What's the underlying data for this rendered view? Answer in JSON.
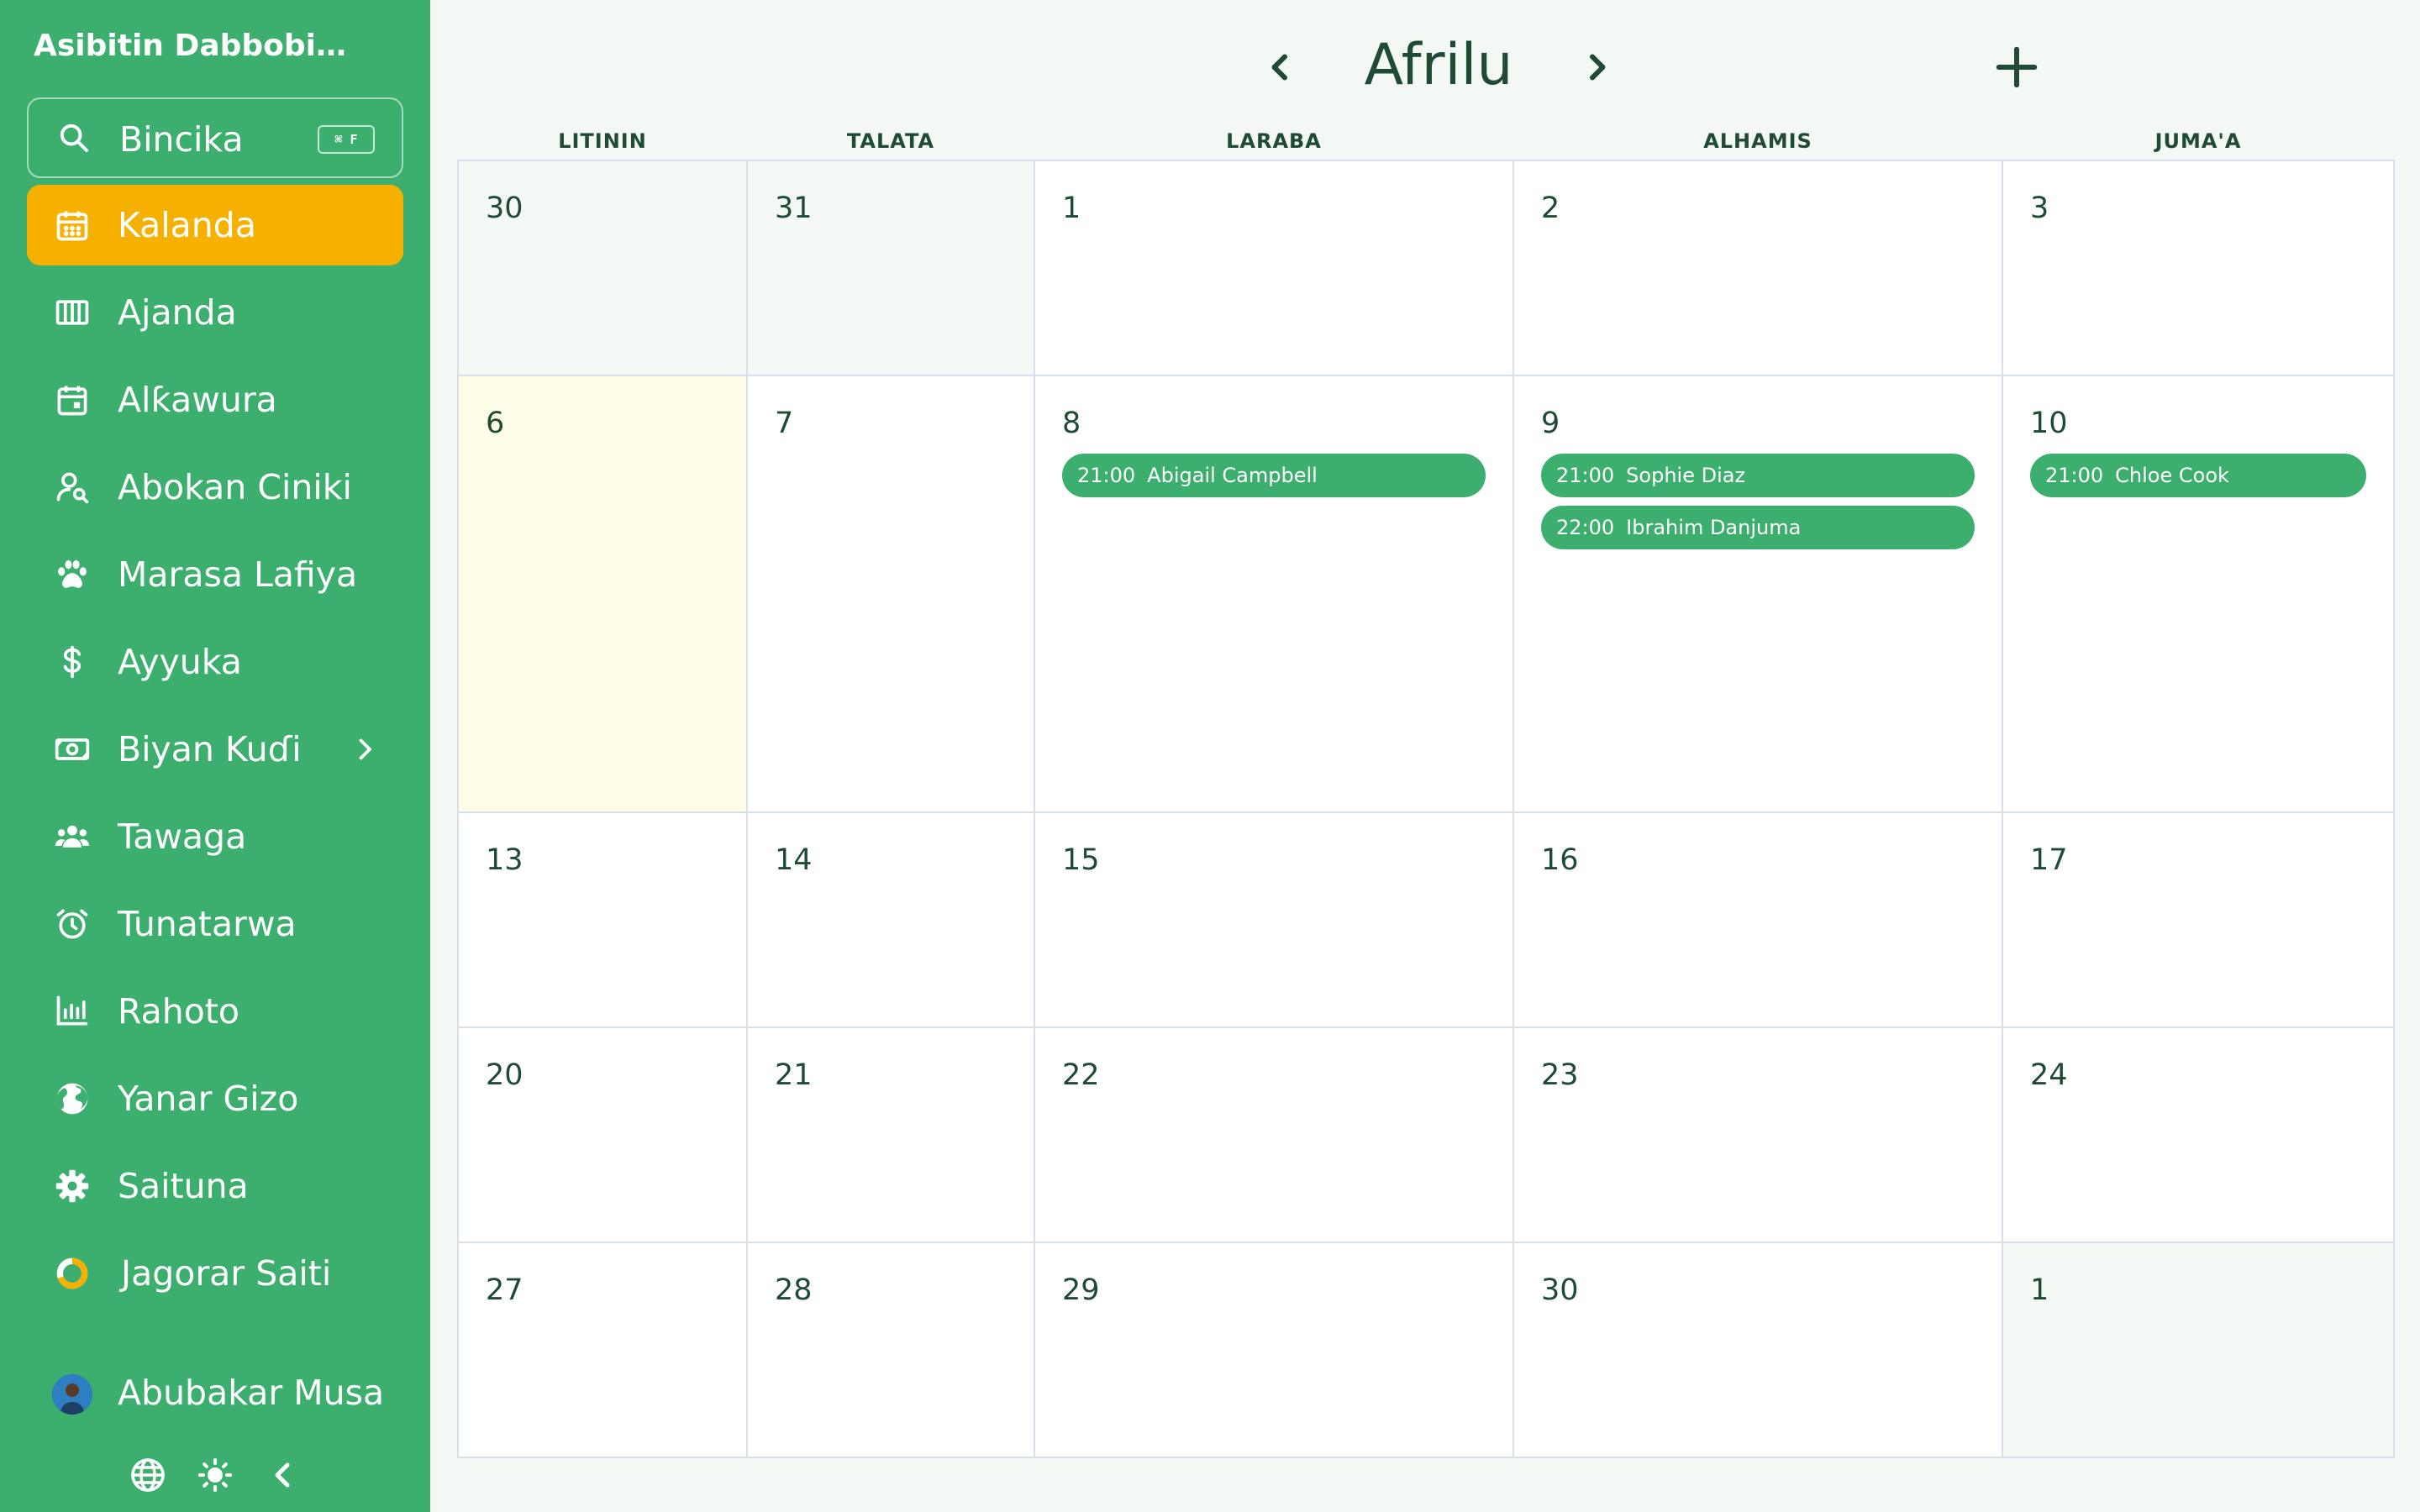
{
  "sidebar": {
    "clinic_name": "Asibitin Dabbobi M...",
    "search": {
      "label": "Bincika",
      "shortcut": "⌘ F"
    },
    "items": [
      {
        "label": "Kalanda",
        "icon": "calendar-icon",
        "active": true
      },
      {
        "label": "Ajanda",
        "icon": "agenda-columns-icon"
      },
      {
        "label": "Alƙawura",
        "icon": "appointment-icon"
      },
      {
        "label": "Abokan Ciniki",
        "icon": "client-search-icon"
      },
      {
        "label": "Marasa Lafiya",
        "icon": "paw-icon"
      },
      {
        "label": "Ayyuka",
        "icon": "dollar-icon"
      },
      {
        "label": "Biyan Kuɗi",
        "icon": "cash-icon",
        "has_submenu": true
      },
      {
        "label": "Tawaga",
        "icon": "team-icon"
      },
      {
        "label": "Tunatarwa",
        "icon": "alarm-icon"
      },
      {
        "label": "Rahoto",
        "icon": "bar-chart-icon"
      },
      {
        "label": "Yanar Gizo",
        "icon": "globe-icon"
      },
      {
        "label": "Saituna",
        "icon": "gear-icon"
      },
      {
        "label": "Jagorar Saiti",
        "icon": "progress-ring-icon"
      }
    ],
    "user": {
      "name": "Abubakar Musa"
    },
    "tools": [
      "language-globe-icon",
      "theme-sun-icon",
      "collapse-chevron-icon"
    ]
  },
  "header": {
    "month": "Afrilu",
    "prev_icon": "chevron-left-icon",
    "next_icon": "chevron-right-icon",
    "add_icon": "plus-icon"
  },
  "calendar": {
    "weekdays": [
      "LITININ",
      "TALATA",
      "LARABA",
      "ALHAMIS",
      "JUMA'A"
    ],
    "weeks": [
      [
        {
          "day": "30",
          "out": true
        },
        {
          "day": "31",
          "out": true
        },
        {
          "day": "1"
        },
        {
          "day": "2"
        },
        {
          "day": "3"
        }
      ],
      [
        {
          "day": "6",
          "today": true
        },
        {
          "day": "7"
        },
        {
          "day": "8",
          "events": [
            {
              "time": "21:00",
              "name": "Abigail Campbell"
            }
          ]
        },
        {
          "day": "9",
          "events": [
            {
              "time": "21:00",
              "name": "Sophie Diaz"
            },
            {
              "time": "22:00",
              "name": "Ibrahim Danjuma"
            }
          ]
        },
        {
          "day": "10",
          "events": [
            {
              "time": "21:00",
              "name": "Chloe Cook"
            }
          ]
        }
      ],
      [
        {
          "day": "13"
        },
        {
          "day": "14"
        },
        {
          "day": "15"
        },
        {
          "day": "16"
        },
        {
          "day": "17"
        }
      ],
      [
        {
          "day": "20"
        },
        {
          "day": "21"
        },
        {
          "day": "22"
        },
        {
          "day": "23"
        },
        {
          "day": "24"
        }
      ],
      [
        {
          "day": "27"
        },
        {
          "day": "28"
        },
        {
          "day": "29"
        },
        {
          "day": "30"
        },
        {
          "day": "1",
          "out": true
        }
      ]
    ]
  },
  "colors": {
    "sidebar": "#3caf6f",
    "active": "#f5b000",
    "event": "#3caf6f",
    "today": "#fefee8",
    "text": "#1f4a33"
  }
}
